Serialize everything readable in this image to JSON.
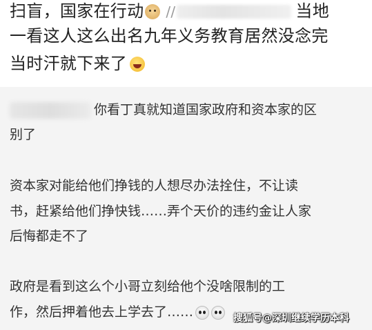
{
  "post": {
    "line1_a": "扫盲，国家在行动",
    "line1_b": "//",
    "line1_c": "当地",
    "line2": "一看这人这么出名九年义务教育居然没念完",
    "line3": "当时汗就下来了",
    "emoji_1": "doge-icon",
    "emoji_2": "laugh-cry-icon"
  },
  "comment": {
    "line1": "你看丁真就知道国家政府和资本家的区",
    "line2": "别了",
    "line3": "资本家对能给他们挣钱的人想尽办法拴住，不让读",
    "line4": "书，赶紧给他们挣快钱……弄个天价的违约金让人家",
    "line5": "后悔都走不了",
    "line6": "政府是看到这么个小哥立刻给他个没啥限制的工",
    "line7": "作，然后押着他去上学去了……",
    "emoji": "crying-face-icon"
  },
  "watermark": "搜狐号@深圳继续学历本科",
  "colors": {
    "post_bg": "#ffffff",
    "comment_bg": "#f4f4f4",
    "text": "#333333"
  }
}
